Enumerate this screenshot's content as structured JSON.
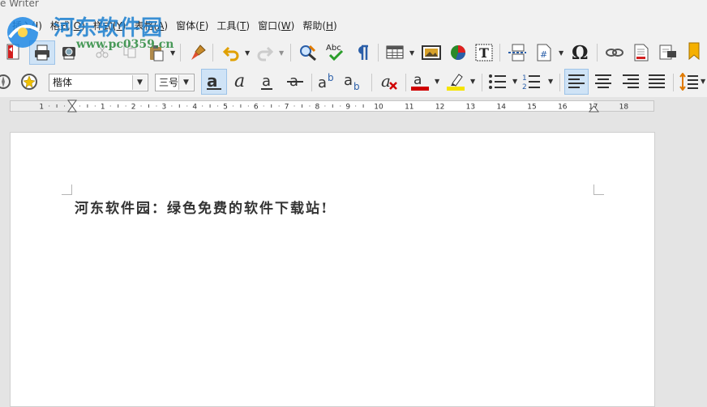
{
  "window": {
    "title": "e Writer"
  },
  "menu": [
    {
      "label": "插入(",
      "key": "I",
      "tail": ")"
    },
    {
      "label": "格式(",
      "key": "O",
      "tail": ")"
    },
    {
      "label": "样式(",
      "key": "Y",
      "tail": ")"
    },
    {
      "label": "表格(",
      "key": "A",
      "tail": ")"
    },
    {
      "label": "窗体(",
      "key": "F",
      "tail": ")"
    },
    {
      "label": "工具(",
      "key": "T",
      "tail": ")"
    },
    {
      "label": "窗口(",
      "key": "W",
      "tail": ")"
    },
    {
      "label": "帮助(",
      "key": "H",
      "tail": ")"
    }
  ],
  "watermark": {
    "text": "河东软件园",
    "url": "www.pc0359.cn"
  },
  "toolbar2": {
    "font_name": "楷体",
    "font_size": "三号"
  },
  "ruler": {
    "labels": [
      "1",
      "1",
      "2",
      "3",
      "4",
      "5",
      "6",
      "7",
      "8",
      "9",
      "10",
      "11",
      "12",
      "13",
      "14",
      "15",
      "16",
      "17",
      "18"
    ]
  },
  "document": {
    "text": "河东软件园：绿色免费的软件下载站!"
  },
  "colors": {
    "accent_blue": "#1a7fd0",
    "font_color_bar": "#d00000",
    "highlight_bar": "#f5e400",
    "active_button": "#cfe3f6"
  },
  "icons": {
    "toolbar1": [
      "export-pdf-icon",
      "print-icon",
      "print-preview-icon",
      "cut-icon",
      "copy-icon",
      "paste-icon",
      "clone-formatting-icon",
      "undo-icon",
      "redo-icon",
      "find-replace-icon",
      "spelling-icon",
      "formatting-marks-icon",
      "insert-table-icon",
      "insert-image-icon",
      "insert-chart-icon",
      "insert-textbox-icon",
      "insert-page-break-icon",
      "insert-field-icon",
      "special-character-icon",
      "hyperlink-icon",
      "footnote-icon",
      "comment-icon",
      "bookmark-icon"
    ],
    "toolbar2": [
      "navigator-icon",
      "gallery-icon",
      "bold-icon",
      "italic-icon",
      "underline-icon",
      "strikethrough-icon",
      "superscript-icon",
      "subscript-icon",
      "clear-formatting-icon",
      "font-color-icon",
      "highlight-icon",
      "bullet-list-icon",
      "numbered-list-icon",
      "align-left-icon",
      "align-center-icon",
      "align-right-icon",
      "justify-icon",
      "line-spacing-icon"
    ]
  }
}
